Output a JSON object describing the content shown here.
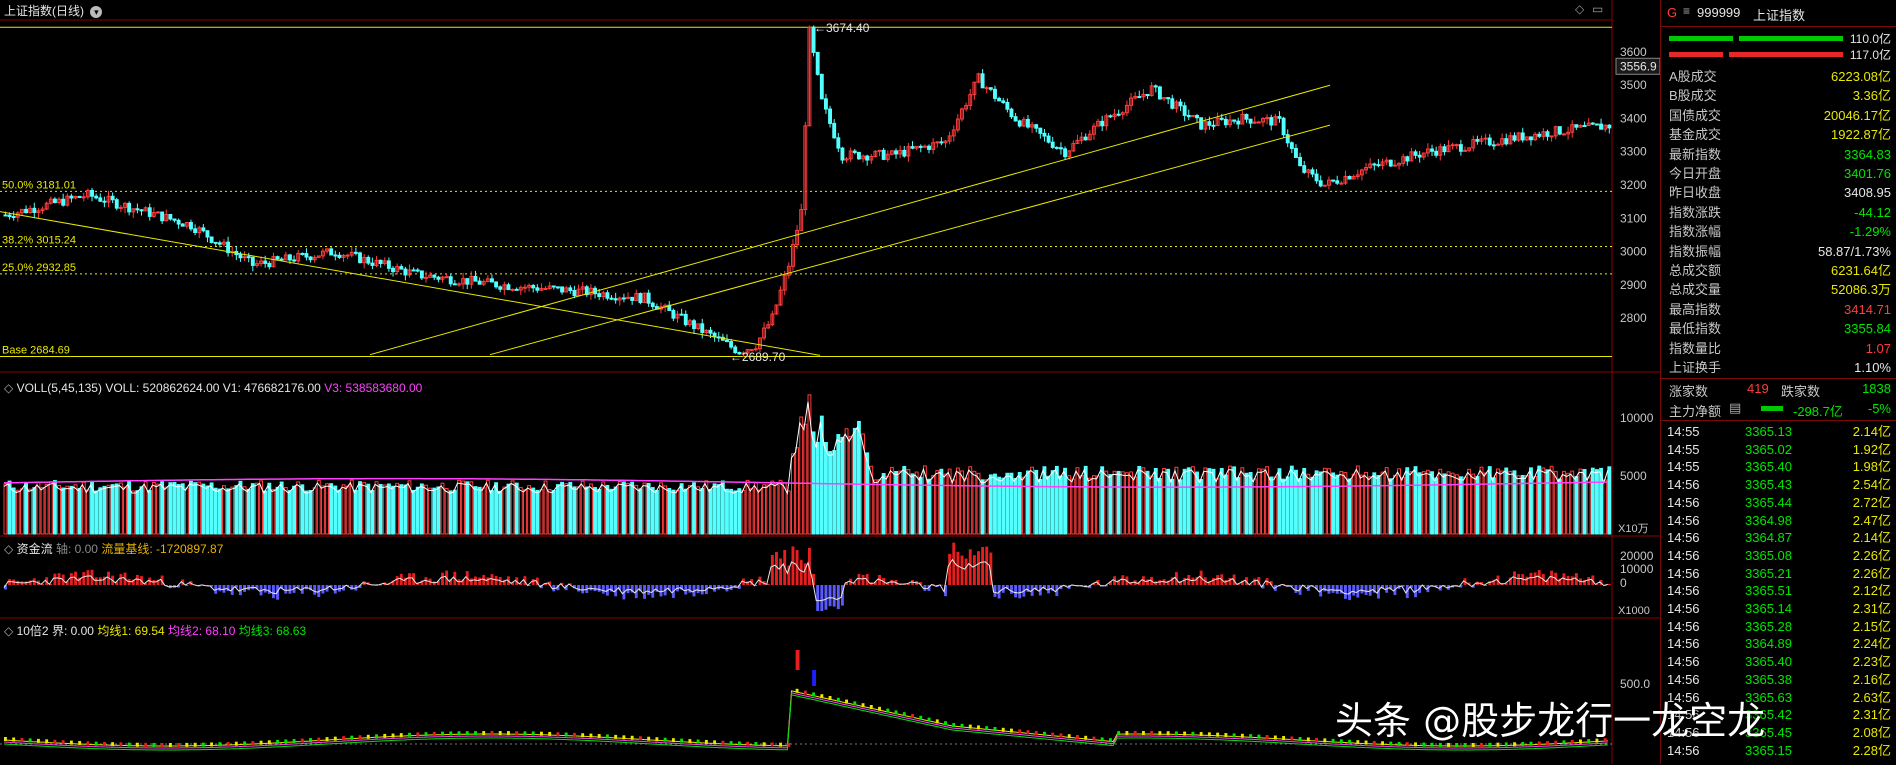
{
  "chart": {
    "title": "上证指数(日线)",
    "price_axis_labels": [
      "3600",
      "3500",
      "3400",
      "3300",
      "3200",
      "3100",
      "3000",
      "2900",
      "2800"
    ],
    "current_price_tag": "3556.9",
    "high_label": "3674.40",
    "low_label": "2689.70",
    "fib_levels": [
      {
        "label": "50.0% 3181.01",
        "price": 3181.01
      },
      {
        "label": "38.2% 3015.24",
        "price": 3015.24
      },
      {
        "label": "25.0% 2932.85",
        "price": 2932.85
      },
      {
        "label": "Base 2684.69",
        "price": 2684.69
      }
    ],
    "price_range": [
      2680,
      3690
    ]
  },
  "volume_panel": {
    "legend_name": "VOLL(5,45,135)",
    "legend_voll": "VOLL: 520862624.00",
    "legend_v1": "V1: 476682176.00",
    "legend_v3": "V3: 538583680.00",
    "axis_labels": [
      "10000",
      "5000"
    ],
    "unit": "X10万"
  },
  "flow_panel": {
    "legend_name": "资金流",
    "legend_axis": "轴: 0.00",
    "legend_base": "流量基线: -1720897.87",
    "axis_labels": [
      "20000",
      "10000",
      "0"
    ],
    "unit": "X1000"
  },
  "ten_panel": {
    "legend_name": "10倍2",
    "legend_jie": "界: 0.00",
    "legend_ma1": "均线1: 69.54",
    "legend_ma2": "均线2: 68.10",
    "legend_ma3": "均线3: 68.63",
    "axis_labels": [
      "500.0"
    ]
  },
  "sidebar": {
    "g_mark": "G",
    "code": "999999",
    "name": "上证指数",
    "bar1_value": "110.0亿",
    "bar2_value": "117.0亿",
    "stats": [
      {
        "label": "A股成交",
        "value": "6223.08亿",
        "color": "yel"
      },
      {
        "label": "B股成交",
        "value": "3.36亿",
        "color": "yel"
      },
      {
        "label": "国债成交",
        "value": "20046.17亿",
        "color": "yel"
      },
      {
        "label": "基金成交",
        "value": "1922.87亿",
        "color": "yel"
      },
      {
        "label": "最新指数",
        "value": "3364.83",
        "color": "green"
      },
      {
        "label": "今日开盘",
        "value": "3401.76",
        "color": "green"
      },
      {
        "label": "昨日收盘",
        "value": "3408.95",
        "color": "white"
      },
      {
        "label": "指数涨跌",
        "value": "-44.12",
        "color": "green"
      },
      {
        "label": "指数涨幅",
        "value": "-1.29%",
        "color": "green"
      },
      {
        "label": "指数振幅",
        "value": "58.87/1.73%",
        "color": "white"
      },
      {
        "label": "总成交额",
        "value": "6231.64亿",
        "color": "yel"
      },
      {
        "label": "总成交量",
        "value": "52086.3万",
        "color": "yel"
      },
      {
        "label": "最高指数",
        "value": "3414.71",
        "color": "red"
      },
      {
        "label": "最低指数",
        "value": "3355.84",
        "color": "green"
      },
      {
        "label": "指数量比",
        "value": "1.07",
        "color": "red"
      },
      {
        "label": "上证换手",
        "value": "1.10%",
        "color": "white"
      }
    ],
    "up_label": "涨家数",
    "up_value": "419",
    "down_label": "跌家数",
    "down_value": "1838",
    "flow_label": "主力净额",
    "flow_value": "-298.7亿",
    "flow_pct": "-5%",
    "ticks": [
      {
        "time": "14:55",
        "price": "3365.13",
        "vol": "2.14亿"
      },
      {
        "time": "14:55",
        "price": "3365.02",
        "vol": "1.92亿"
      },
      {
        "time": "14:55",
        "price": "3365.40",
        "vol": "1.98亿"
      },
      {
        "time": "14:56",
        "price": "3365.43",
        "vol": "2.54亿"
      },
      {
        "time": "14:56",
        "price": "3365.44",
        "vol": "2.72亿"
      },
      {
        "time": "14:56",
        "price": "3364.98",
        "vol": "2.47亿"
      },
      {
        "time": "14:56",
        "price": "3364.87",
        "vol": "2.14亿"
      },
      {
        "time": "14:56",
        "price": "3365.08",
        "vol": "2.26亿"
      },
      {
        "time": "14:56",
        "price": "3365.21",
        "vol": "2.26亿"
      },
      {
        "time": "14:56",
        "price": "3365.51",
        "vol": "2.12亿"
      },
      {
        "time": "14:56",
        "price": "3365.14",
        "vol": "2.31亿"
      },
      {
        "time": "14:56",
        "price": "3365.28",
        "vol": "2.15亿"
      },
      {
        "time": "14:56",
        "price": "3364.89",
        "vol": "2.24亿"
      },
      {
        "time": "14:56",
        "price": "3365.40",
        "vol": "2.23亿"
      },
      {
        "time": "14:56",
        "price": "3365.38",
        "vol": "2.16亿"
      },
      {
        "time": "14:56",
        "price": "3365.63",
        "vol": "2.63亿"
      },
      {
        "time": "14:56",
        "price": "3365.42",
        "vol": "2.31亿"
      },
      {
        "time": "14:56",
        "price": "3365.45",
        "vol": "2.08亿"
      },
      {
        "time": "14:56",
        "price": "3365.15",
        "vol": "2.28亿"
      }
    ]
  },
  "watermark": "头条 @股步龙行一龙空龙",
  "colors": {
    "up": "#ff3c3c",
    "down": "#54ffff",
    "fib": "#e8e800",
    "magenta": "#ff40ff",
    "flow_neg": "#5a5aff"
  }
}
